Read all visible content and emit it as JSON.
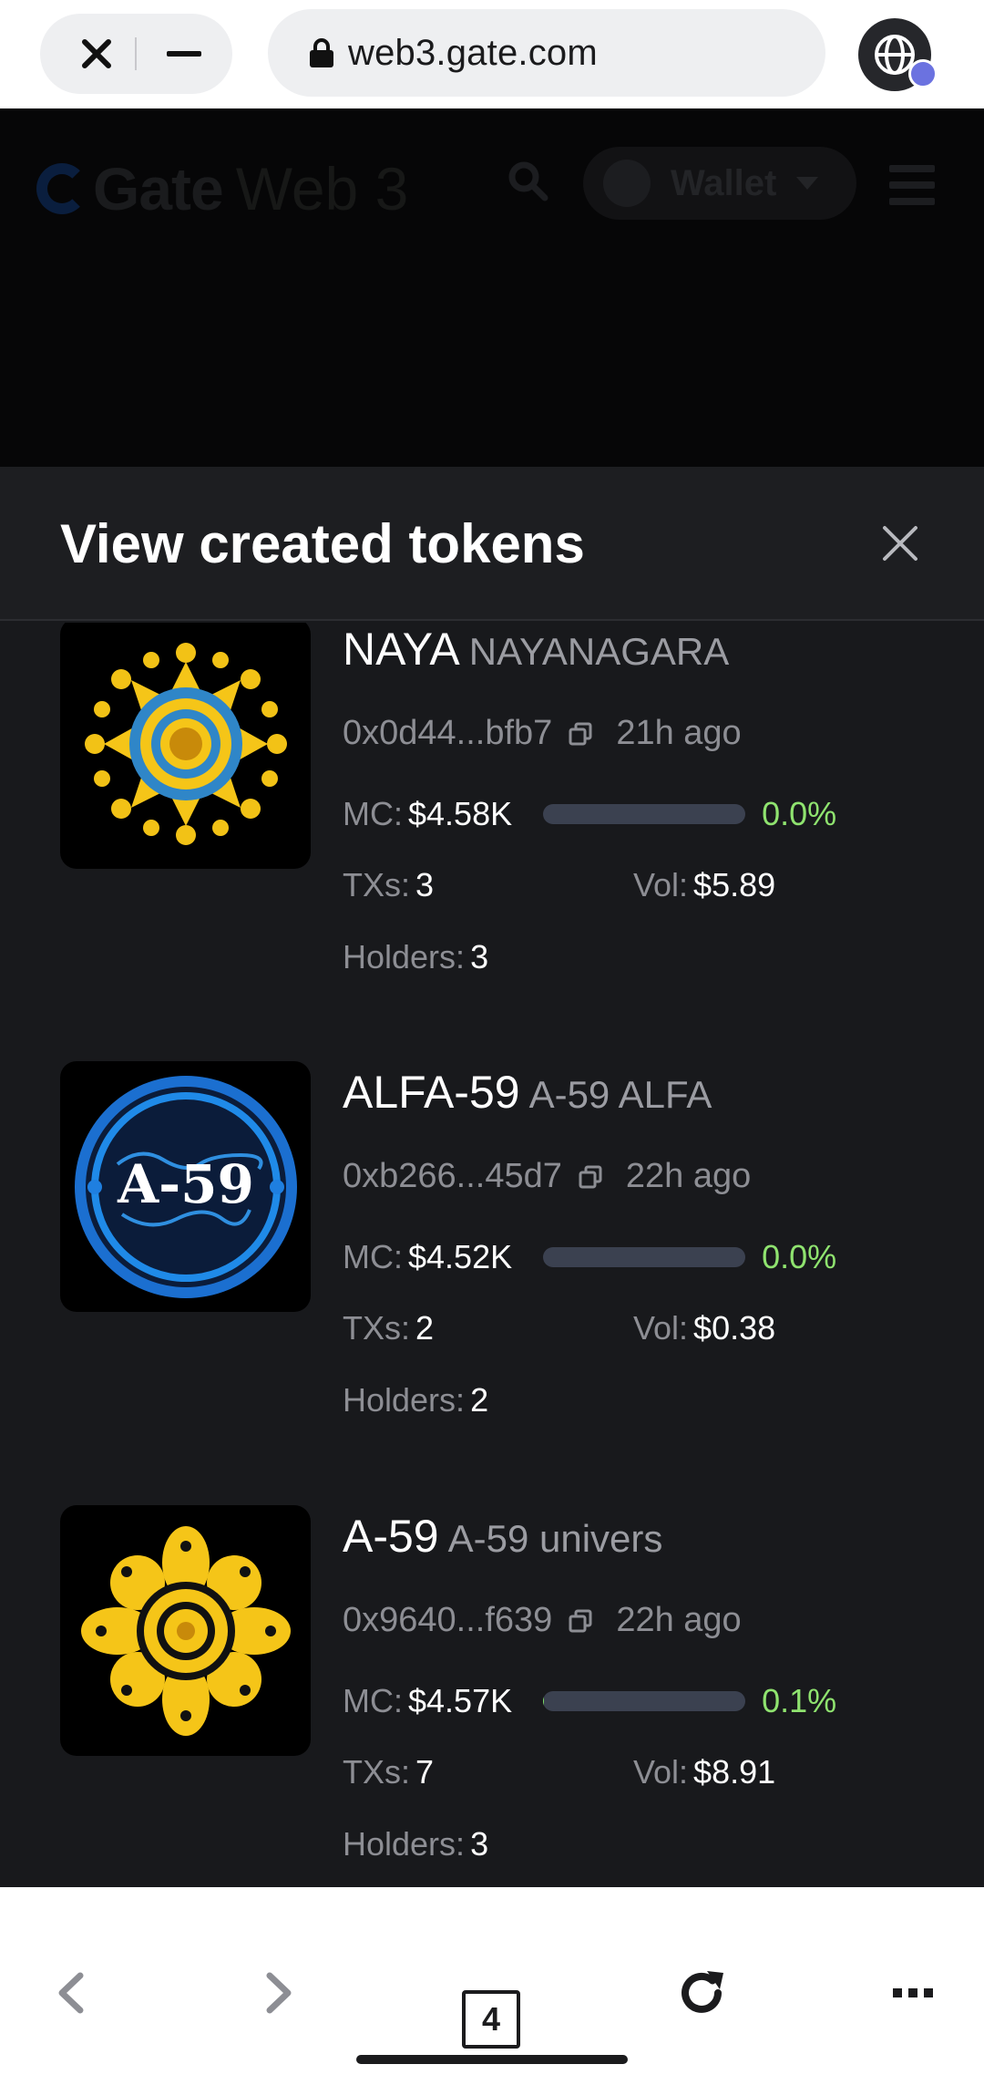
{
  "browser": {
    "url": "web3.gate.com",
    "tab_count": "4"
  },
  "site_header": {
    "brand": "Gate",
    "brand_suffix": "Web 3",
    "wallet_label": "Wallet"
  },
  "sheet": {
    "title": "View created tokens"
  },
  "labels": {
    "mc": "MC:",
    "txs": "TXs:",
    "vol": "Vol:",
    "holders": "Holders:"
  },
  "tokens": [
    {
      "symbol": "NAYA",
      "name": "NAYANAGARA",
      "address": "0x0d44...bfb7",
      "age": "21h ago",
      "market_cap": "$4.58K",
      "progress_percent": 0.0,
      "progress_label": "0.0%",
      "txs": "3",
      "volume": "$5.89",
      "holders": "3",
      "logo_icon": "yellow-mandala-icon",
      "accent": "#f5c518"
    },
    {
      "symbol": "ALFA-59",
      "name": "A-59 ALFA",
      "address": "0xb266...45d7",
      "age": "22h ago",
      "market_cap": "$4.52K",
      "progress_percent": 0.0,
      "progress_label": "0.0%",
      "txs": "2",
      "volume": "$0.38",
      "holders": "2",
      "logo_icon": "a59-globe-badge-icon",
      "logo_text": "A-59",
      "accent": "#1f7fe0"
    },
    {
      "symbol": "A-59",
      "name": "A-59 univers",
      "address": "0x9640...f639",
      "age": "22h ago",
      "market_cap": "$4.57K",
      "progress_percent": 0.1,
      "progress_label": "0.1%",
      "txs": "7",
      "volume": "$8.91",
      "holders": "3",
      "logo_icon": "yellow-flower-mandala-icon",
      "accent": "#f5c518"
    }
  ],
  "colors": {
    "sheet_bg": "#18191c",
    "positive": "#8fe36f",
    "muted_text": "#8d8e94",
    "progress_track": "#3b4150"
  }
}
